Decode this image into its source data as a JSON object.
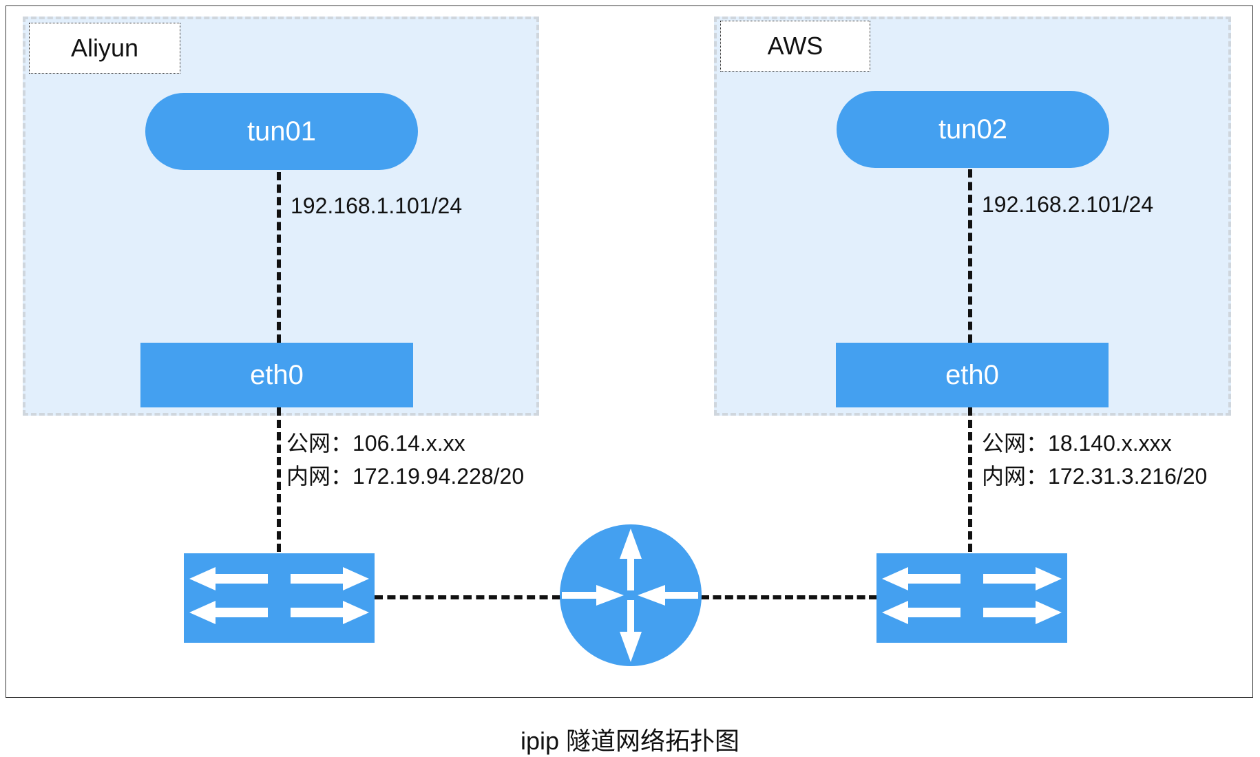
{
  "left_site": {
    "label": "Aliyun",
    "tunnel": {
      "name": "tun01",
      "ip": "192.168.1.101/24"
    },
    "interface": {
      "name": "eth0",
      "public_label": "公网：",
      "public_ip": "106.14.x.xx",
      "private_label": "内网：",
      "private_ip": "172.19.94.228/20"
    }
  },
  "right_site": {
    "label": "AWS",
    "tunnel": {
      "name": "tun02",
      "ip": "192.168.2.101/24"
    },
    "interface": {
      "name": "eth0",
      "public_label": "公网：",
      "public_ip": "18.140.x.xxx",
      "private_label": "内网：",
      "private_ip": "172.31.3.216/20"
    }
  },
  "icons": {
    "switch": "switch-icon",
    "router": "router-icon"
  },
  "colors": {
    "node_fill": "#44a0f0",
    "region_fill": "#e2effc",
    "region_border": "#cfd6dd",
    "link": "#111111"
  },
  "caption": "ipip 隧道网络拓扑图"
}
